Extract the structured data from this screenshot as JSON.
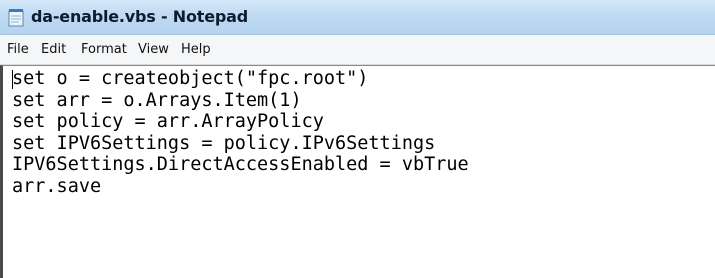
{
  "window": {
    "title": "da-enable.vbs - Notepad",
    "icon": "notepad-icon"
  },
  "menu": {
    "items": [
      "File",
      "Edit",
      "Format",
      "View",
      "Help"
    ]
  },
  "editor": {
    "lines": [
      "set o = createobject(\"fpc.root\")",
      "set arr = o.Arrays.Item(1)",
      "set policy = arr.ArrayPolicy",
      "set IPV6Settings = policy.IPv6Settings",
      "IPV6Settings.DirectAccessEnabled = vbTrue",
      "arr.save"
    ]
  },
  "colors": {
    "titlebar": "#c0daf3",
    "menubar": "#f5f6f7",
    "editor_bg": "#ffffff",
    "text": "#000000"
  }
}
